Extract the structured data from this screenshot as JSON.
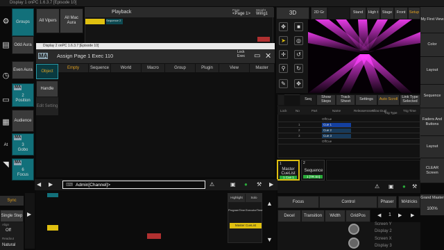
{
  "window_title": "Display 1 onPC 1.6.3.7 [Episode 10]",
  "left_icons": {
    "gear": "⚙",
    "color": "▤",
    "time": "◷",
    "window": "▭",
    "grid": "▦",
    "at_label": "At",
    "scroll": "◥"
  },
  "left_col": {
    "groups": "Groups",
    "odd_aura": "Odd Aura",
    "even_aura": "Even Aura",
    "ma_badge": "MA",
    "position_num": "2",
    "position": "Position",
    "audience": "Audience",
    "gobo_num": "3",
    "gobo": "Gobo",
    "focus_num": "6",
    "focus": "Focus"
  },
  "top": {
    "all_vipers": "All Vipers",
    "all_mac_aura": "All Mac Aura",
    "playback": "Playback",
    "page": "Page",
    "page_val": "<Page 1>",
    "weight": "Weight",
    "wing": "Wing1",
    "seq_tiny": "Sequence 2",
    "view_3d": "3D",
    "buttons": [
      "2D Gr",
      "Stand",
      "High t",
      "Stage",
      "Front",
      "Setup"
    ]
  },
  "assign": {
    "title": "Assign Page 1 Exec 110",
    "lock_label": "Lock",
    "exec_label": "Exec",
    "mini_title": "Display 2 onPC 1.6.3.7 [Episode 10]",
    "tabs": [
      "Empty",
      "Sequence",
      "World",
      "Macro",
      "Group",
      "Plugin",
      "View",
      "Master"
    ],
    "side_object": "Object",
    "side_handle": "Handle",
    "side_edit_setting": "Edit Setting"
  },
  "cmdline": {
    "text": "Admin[Channel]>"
  },
  "viz_tools": [
    "✥",
    "■",
    "➤",
    "◎",
    "✛",
    "↺",
    "⚲",
    "↻",
    "✎",
    "✥"
  ],
  "sequence_sheet": {
    "tabs": [
      "Seq",
      "Show Steps",
      "Track Sheet",
      "Settings",
      "Auto Scroll",
      "Link Type Selected"
    ],
    "header": [
      "Lock",
      "No",
      "Part",
      "Name",
      "Release",
      "Assert",
      "Allow Dupl",
      "Trig Type",
      "Trig Time"
    ],
    "rows": [
      {
        "no": "",
        "name": "OffCue",
        "active": false
      },
      {
        "no": "1",
        "name": "Cue 1",
        "active": true
      },
      {
        "no": "2",
        "name": "Cue 2",
        "active": false
      },
      {
        "no": "3",
        "name": "Cue 3",
        "active": false
      },
      {
        "no": "",
        "name": "OffCue",
        "active": false
      }
    ]
  },
  "exec": {
    "master_cuelist_num": "1",
    "master_cuelist": "Master CueList",
    "master_cue": "1 Cue 1",
    "sequence_num": "2",
    "sequence": "Sequence",
    "sequence_sub": "1 [TR Sn]"
  },
  "right_col": [
    "My First View",
    "Color",
    "Layout",
    "Sequence",
    "Faders And Buttons",
    "Layout",
    "CLEAR Screen"
  ],
  "bottom_right": {
    "phaser": "Phaser",
    "matricks": "MAtricks",
    "grand_master": "Grand Master",
    "grand_val": "100%",
    "focus": "Focus",
    "control": "Control",
    "decel": "Decel",
    "transition": "Transition",
    "width": "Width",
    "gridpos": "GridPos",
    "screens": [
      "Screen Y",
      "Display 2",
      "Screen X",
      "Display 3"
    ]
  },
  "bottom_left": {
    "sync": "Sync",
    "single_step": "Single Step",
    "align": "Align",
    "align_val": "Off",
    "readout": "Readout",
    "readout_val": "Natural"
  },
  "lower_exec_labels": {
    "highlight": "Highlight",
    "solo": "Solo",
    "program_time": "ProgramTime",
    "executor_time": "ExecutorTime",
    "master_cuelist": "Master CueList"
  },
  "colors": {
    "teal": "#12707a",
    "yellow": "#e0c010",
    "magenta": "#d020d0",
    "green": "#2aaa3a"
  }
}
